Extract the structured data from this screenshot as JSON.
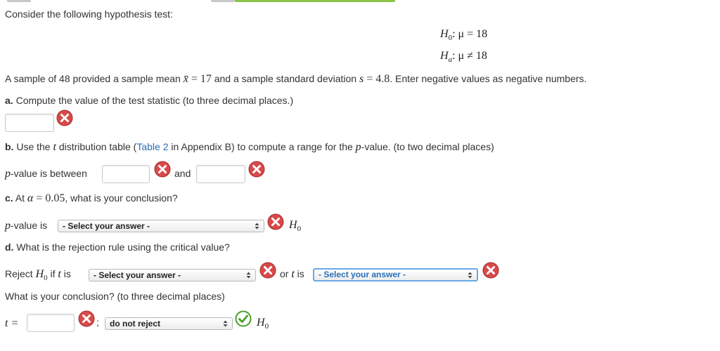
{
  "intro": "Consider the following hypothesis test:",
  "hypotheses": {
    "h0_label": "H",
    "h0_sub": "0",
    "h0_rel": ": μ = 18",
    "ha_label": "H",
    "ha_sub": "a",
    "ha_rel": ": μ ≠ 18"
  },
  "sample": {
    "prefix": "A sample of 48 provided a sample mean ",
    "xbar": "x̄",
    "mean_rel": " = 17",
    "mid": " and a sample standard deviation ",
    "s": "s",
    "sd_rel": " = 4.8",
    "suffix": ". Enter negative values as negative numbers."
  },
  "part_a": {
    "label": "a.",
    "text": " Compute the value of the test statistic (to three decimal places.)"
  },
  "part_b": {
    "label": "b.",
    "text_before_t": " Use the ",
    "t": "t",
    "text_after_t": " distribution table (",
    "link": "Table 2",
    "text_after_link": " in Appendix B) to compute a range for the ",
    "p": "p",
    "text_end": "-value. (to two decimal places)",
    "between_p": "p",
    "between_text": "-value is between",
    "and": "and"
  },
  "part_c": {
    "label": "c.",
    "text_at": " At ",
    "alpha": "α",
    "alpha_val": " = 0.05",
    "text_end": ", what is your conclusion?",
    "pv_p": "p",
    "pv_text": "-value is",
    "select": "- Select your answer -",
    "h0": "H",
    "h0_sub": "0"
  },
  "part_d": {
    "label": "d.",
    "text": " What is the rejection rule using the critical value?",
    "reject": "Reject ",
    "h0": "H",
    "h0_sub": "0",
    "if_t": " if ",
    "t": "t",
    "is": " is",
    "select1": "- Select your answer -",
    "or": "or ",
    "select2": "- Select your answer -",
    "conclusion": "What is your conclusion? (to three decimal places)",
    "t_eq": "t =",
    "semicolon": ";",
    "decision": "do not reject",
    "h0_end": "H",
    "h0_end_sub": "0"
  },
  "colors": {
    "incorrect": "#cc3333",
    "correct": "#4aa02c",
    "link": "#2a6fb8",
    "tab_green": "#8bc34a"
  }
}
